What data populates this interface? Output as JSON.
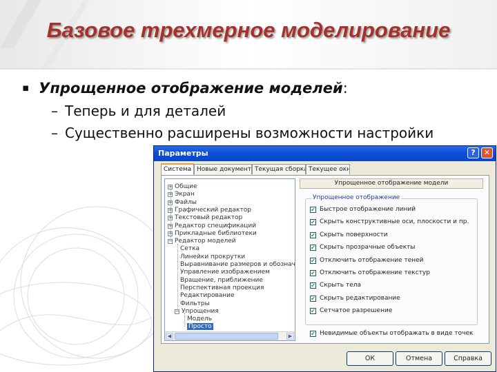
{
  "slide": {
    "title": "Базовое трехмерное моделирование",
    "bullet_main": "Упрощенное отображение моделей",
    "bullet_main_suffix": ":",
    "sub_bullets": [
      "Теперь и для деталей",
      "Существенно расширены возможности настройки"
    ]
  },
  "dialog": {
    "title": "Параметры",
    "help_glyph": "?",
    "close_glyph": "✕",
    "tabs": [
      "Система",
      "Новые документы",
      "Текущая сборка",
      "Текущее окно"
    ],
    "active_tab_index": 0,
    "tree": [
      {
        "label": "Общие",
        "expander": "+"
      },
      {
        "label": "Экран",
        "expander": "+"
      },
      {
        "label": "Файлы",
        "expander": "+"
      },
      {
        "label": "Графический редактор",
        "expander": "+"
      },
      {
        "label": "Текстовый редактор",
        "expander": "+"
      },
      {
        "label": "Редактор спецификаций",
        "expander": "+"
      },
      {
        "label": "Прикладные библиотеки",
        "expander": "+"
      },
      {
        "label": "Редактор моделей",
        "expander": "−"
      },
      {
        "label": "Сетка",
        "expander": ""
      },
      {
        "label": "Линейки прокрутки",
        "expander": ""
      },
      {
        "label": "Выравнивание размеров и обозначений",
        "expander": ""
      },
      {
        "label": "Управление изображением",
        "expander": ""
      },
      {
        "label": "Вращение, приближение",
        "expander": ""
      },
      {
        "label": "Перспективная проекция",
        "expander": ""
      },
      {
        "label": "Редактирование",
        "expander": ""
      },
      {
        "label": "Фильтры",
        "expander": ""
      },
      {
        "label": "Упрощения",
        "expander": "−"
      },
      {
        "label": "Модель",
        "expander": ""
      },
      {
        "label": "Просто",
        "expander": "",
        "selected": true
      }
    ],
    "panel_header": "Упрощенное отображение модели",
    "group_title": "Упрощенное отображение",
    "checkboxes": [
      {
        "label": "Быстрое отображение линий",
        "checked": true
      },
      {
        "label": "Скрыть конструктивные оси, плоскости и пр.",
        "checked": true
      },
      {
        "label": "Скрыть поверхности",
        "checked": true
      },
      {
        "label": "Скрыть прозрачные объекты",
        "checked": true
      },
      {
        "label": "Отключить отображение теней",
        "checked": true
      },
      {
        "label": "Отключить отображение текстур",
        "checked": true
      },
      {
        "label": "Скрыть тела",
        "checked": true
      },
      {
        "label": "Скрыть редактирование",
        "checked": true
      },
      {
        "label": "Сетчатое разрешение",
        "checked": true
      }
    ],
    "bottom_checkbox": {
      "label": "Невидимые объекты отображать в виде точек",
      "checked": true
    },
    "check_glyph": "✔",
    "buttons": {
      "ok": "ОК",
      "cancel": "Отмена",
      "help": "Справка"
    }
  },
  "colors": {
    "title_red": "#a4312b",
    "xp_blue": "#0b4fd6",
    "dialog_face": "#ece9d8"
  }
}
